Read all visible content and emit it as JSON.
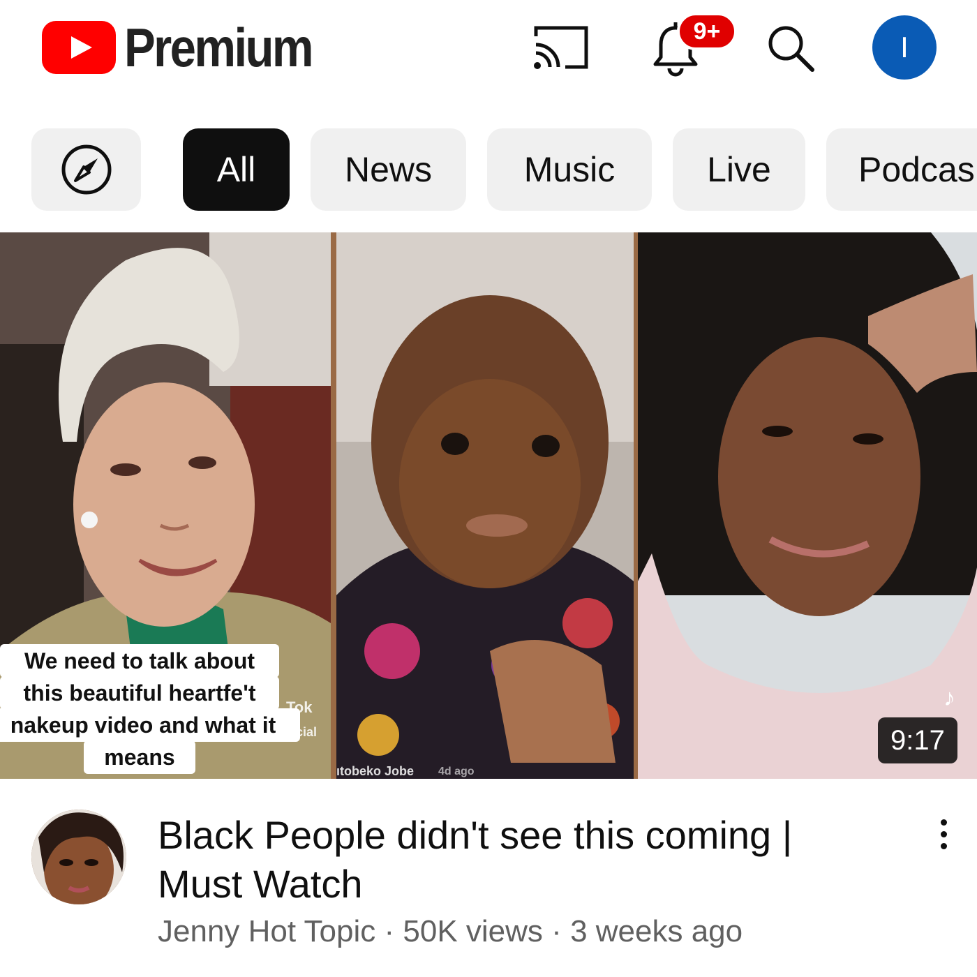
{
  "header": {
    "logo_text": "Premium",
    "notification_count": "9+",
    "account_initial": "I",
    "icons": [
      "youtube-logo-icon",
      "cast-icon",
      "bell-icon",
      "search-icon"
    ]
  },
  "chips": {
    "explore_icon": "compass-icon",
    "items": [
      {
        "label": "All",
        "active": true
      },
      {
        "label": "News",
        "active": false
      },
      {
        "label": "Music",
        "active": false
      },
      {
        "label": "Live",
        "active": false
      },
      {
        "label": "Podcas",
        "active": false
      }
    ]
  },
  "video": {
    "thumbnail_caption": {
      "line1": "We need to talk about",
      "line2": "this beautiful heartfe't",
      "line3": "nakeup video and what it",
      "line4": "means"
    },
    "overlay_texts": {
      "tiktok_1": "Tok",
      "social": "cial",
      "creator_name": "ıtobeko Jobe",
      "time_ago": "4d ago"
    },
    "duration": "9:17",
    "title": "Black People didn't see this coming | Must Watch",
    "channel": "Jenny Hot Topic",
    "views": "50K views",
    "uploaded": "3 weeks ago",
    "separator": "·"
  },
  "colors": {
    "brand_red": "#ff0000",
    "badge_red": "#e00000",
    "avatar_blue": "#0a5bb5",
    "chip_bg": "#f0f0f0",
    "chip_active_bg": "#0f0f0f",
    "meta_text": "#606060"
  }
}
